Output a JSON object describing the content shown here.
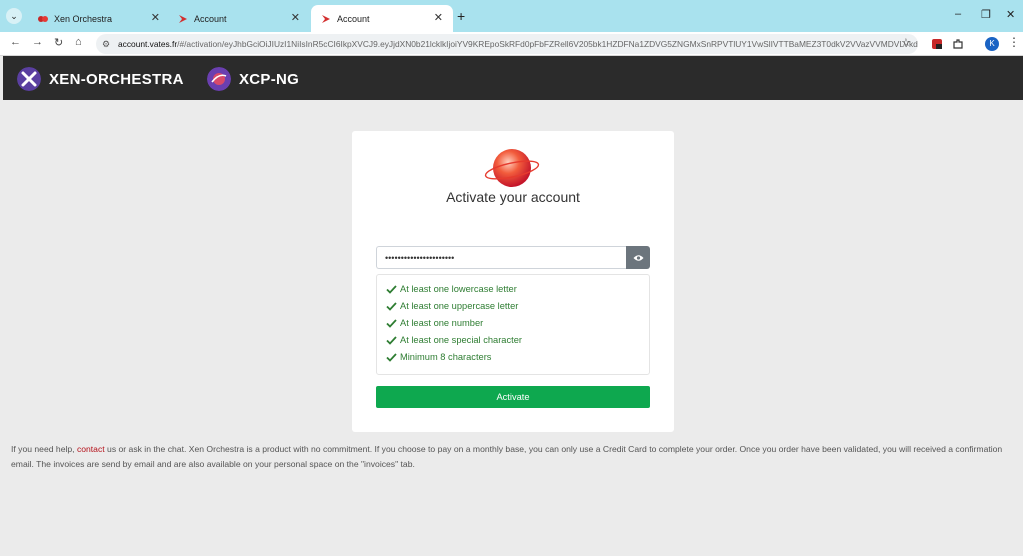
{
  "browser": {
    "tabs": [
      {
        "title": "Xen Orchestra",
        "active": false
      },
      {
        "title": "Account",
        "active": false
      },
      {
        "title": "Account",
        "active": true
      }
    ],
    "address": {
      "host": "account.vates.fr",
      "path": "/#/activation/eyJhbGciOiJIUzI1NiIsInR5cCI6IkpXVCJ9.eyJjdXN0b21lcklkIjoiYV9KREpoSkRFd0pFbFZRell6V205bk1HZDFNa1ZDVG5ZNGMxSnRPVTlUY1VwSlIVTTBaMEZ3T0dkV2VVazVVMDVLVkdSU..."
    },
    "avatar_letter": "K"
  },
  "site": {
    "brands": [
      {
        "name": "XEN-ORCHESTRA"
      },
      {
        "name": "XCP-NG"
      }
    ]
  },
  "card": {
    "title": "Activate your account",
    "password_value": "••••••••••••••••••••••",
    "requirements": [
      "At least one lowercase letter",
      "At least one uppercase letter",
      "At least one number",
      "At least one special character",
      "Minimum 8 characters"
    ],
    "activate_label": "Activate"
  },
  "help": {
    "before_link": "If you need help, ",
    "link": "contact",
    "after_link": " us or ask in the chat. Xen Orchestra is a product with no commitment. If you choose to pay on a monthly base, you can only use a Credit Card to complete your order. Once you order have been validated, you will received a confirmation email. The invoices are send by email and are also available on your personal space on the \"invoices\" tab."
  },
  "colors": {
    "tabbar": "#a9e2ee",
    "header": "#2b2b2b",
    "activate": "#0ea84f",
    "requirement_ok": "#2e7d32",
    "link": "#b5121b"
  }
}
